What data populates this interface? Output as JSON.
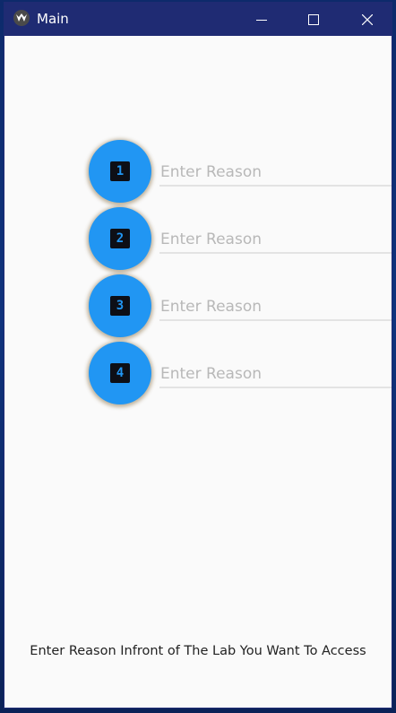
{
  "window": {
    "title": "Main",
    "controls": {
      "minimize_icon": "minimize-icon",
      "maximize_icon": "maximize-icon",
      "close_icon": "close-icon"
    },
    "colors": {
      "titlebar": "#1f2b73",
      "background": "#fafafa"
    }
  },
  "reasons": [
    {
      "number": "1",
      "placeholder": "Enter Reason",
      "value": ""
    },
    {
      "number": "2",
      "placeholder": "Enter Reason",
      "value": ""
    },
    {
      "number": "3",
      "placeholder": "Enter Reason",
      "value": ""
    },
    {
      "number": "4",
      "placeholder": "Enter Reason",
      "value": ""
    }
  ],
  "accent_color": "#2196f3",
  "footer": {
    "text": "Enter Reason Infront of The Lab You Want To Access"
  }
}
